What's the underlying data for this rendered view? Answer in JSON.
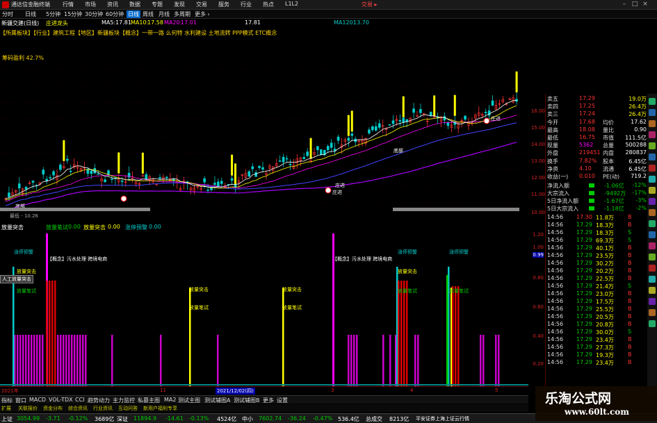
{
  "window": {
    "app_name": "通达信金融终端",
    "broker": "交易 ▸",
    "menu": [
      "行情",
      "市场",
      "资讯",
      "数据",
      "专题",
      "发现",
      "交易",
      "服务",
      "行业",
      "热点",
      "L1L2"
    ]
  },
  "periods": [
    "分时",
    "日线",
    "5分钟",
    "15分钟",
    "30分钟",
    "60分钟",
    "日线",
    "周线",
    "月线",
    "多周期",
    "更多 ›"
  ],
  "active_period_index": 6,
  "stock": {
    "name": "新疆交建(日线)",
    "indicator": "庄进龙头",
    "ma5_label": "MA5:",
    "ma5": "17.81",
    "ma10_label": "MA10:",
    "ma10": "17.58",
    "ma20_label": "MA20:",
    "ma20": "17.01",
    "ma_other": "17.81",
    "ma120_label": "MA120:",
    "ma120": "13.70"
  },
  "tags": "【所属板块】【行业】建筑工程【地区】新疆板块【概念】一带一路 么何特 水利建设 土地流转 PPP模式 ETC概念",
  "profit_label": "筹码盈利 42.7%",
  "chart_annotations": {
    "buy1": "庄进",
    "buy2": "庄进",
    "buy3": "庄进",
    "mark1": "底部",
    "mark2": "底部",
    "lowest": "最低 - 10.26"
  },
  "price_axis": [
    "16.00",
    "15.00",
    "14.00",
    "13.00",
    "12.00",
    "11.00",
    "10.00"
  ],
  "indicator_header": {
    "name": "放量突击",
    "v1_label": "放量笔试",
    "v1": "0.00",
    "v2_label": "放量突击",
    "v2": "0.00",
    "v3_label": "涨停预警",
    "v3": "0.00"
  },
  "ind_axis": [
    "1.20",
    "1.00",
    "0.99",
    "0.80",
    "0.60",
    "0.40",
    "0.20",
    "0.00"
  ],
  "ind_annotations": {
    "zt1": "涨停预警",
    "tj1": "放量突击",
    "cs1": "放量笔试",
    "concept1": "【概念】污水处理 跨境电商",
    "concept2": "【概念】污水处理 跨境电商",
    "tj2": "放量突击",
    "cs2": "放量笔试",
    "tj3": "放量突击",
    "cs3": "放量笔试",
    "zt2": "涨停预警",
    "tj4": "放量突击",
    "cs4": "放量笔试",
    "zt3": "涨停预警",
    "cs5": "放量笔试",
    "tooltip": "人工放量突击"
  },
  "dates": [
    "2021年",
    "11",
    "2021/12/02(四)",
    "3",
    "4",
    "5"
  ],
  "tabs": [
    "指标",
    "窗口",
    "MACD",
    "VOL-TDX",
    "CCI",
    "趋势动力",
    "主力监控",
    "私募主图",
    "MA2",
    "测试主图",
    "测试辅图A",
    "测试辅图B",
    "更多",
    "设置"
  ],
  "tabs2": [
    "扩展",
    "关联报价",
    "资金分布",
    "综合资讯",
    "行业资讯",
    "互动问答",
    "新用户福利专享"
  ],
  "status": {
    "sh_label": "上证",
    "sh": "3054.99",
    "sh_chg": "-3.71",
    "sh_pct": "-0.12%",
    "sh_amt": "3689亿",
    "sz_label": "深证",
    "sz": "11894.9",
    "sz_chg": "-14.61",
    "sz_pct": "-0.13%",
    "sz_amt": "4524亿",
    "zx_label": "中小",
    "zx": "7602.74",
    "zx_chg": "-36.24",
    "zx_pct": "-0.47%",
    "zx_amt": "536.4亿",
    "total_label": "总成交",
    "total": "8213亿",
    "source": "平安证券上海上证云行情"
  },
  "quote": [
    {
      "l": "卖五",
      "v": "17.29",
      "r": "",
      "r2": "19.0万"
    },
    {
      "l": "卖四",
      "v": "17.25",
      "r": "",
      "r2": "26.4万"
    },
    {
      "l": "卖三",
      "v": "17.24",
      "r": "",
      "r2": "26.4万"
    },
    {
      "l": "今开",
      "v": "17.68",
      "r": "均价",
      "r2": "17.62"
    },
    {
      "l": "最高",
      "v": "18.08",
      "r": "量比",
      "r2": "0.90"
    },
    {
      "l": "最低",
      "v": "16.75",
      "r": "市值",
      "r2": "111.5亿"
    },
    {
      "l": "现量",
      "v": "5362",
      "r": "总量",
      "r2": "500288"
    },
    {
      "l": "外盘",
      "v": "219451",
      "r": "内盘",
      "r2": "280837"
    },
    {
      "l": "换手",
      "v": "7.82%",
      "r": "股本",
      "r2": "6.45亿"
    },
    {
      "l": "净资",
      "v": "4.10",
      "r": "流通",
      "r2": "6.45亿"
    },
    {
      "l": "收益(一)",
      "v": "0.010",
      "r": "PE(动)",
      "r2": "719.2"
    }
  ],
  "flows": [
    {
      "l": "净流入额",
      "v": "-1.06亿",
      "p": "-12%"
    },
    {
      "l": "大宗流入",
      "v": "-9492万",
      "p": "-17%"
    },
    {
      "l": "5日净流入额",
      "v": "-1.67亿",
      "p": "-3%"
    },
    {
      "l": "5日大宗流入",
      "v": "-1.18亿",
      "p": "-2%"
    }
  ],
  "ticks": [
    {
      "t": "14:56",
      "p": "17.30",
      "v": "11.8万",
      "d": "B"
    },
    {
      "t": "14:56",
      "p": "17.29",
      "v": "18.3万",
      "d": "B"
    },
    {
      "t": "14:56",
      "p": "17.29",
      "v": "18.3万",
      "d": "S"
    },
    {
      "t": "14:56",
      "p": "17.29",
      "v": "69.3万",
      "d": "S"
    },
    {
      "t": "14:56",
      "p": "17.29",
      "v": "40.1万",
      "d": "B"
    },
    {
      "t": "14:56",
      "p": "17.29",
      "v": "23.5万",
      "d": "B"
    },
    {
      "t": "14:56",
      "p": "17.29",
      "v": "30.2万",
      "d": "B"
    },
    {
      "t": "14:56",
      "p": "17.29",
      "v": "20.2万",
      "d": "B"
    },
    {
      "t": "14:56",
      "p": "17.29",
      "v": "22.5万",
      "d": "B"
    },
    {
      "t": "14:56",
      "p": "17.29",
      "v": "21.4万",
      "d": "S"
    },
    {
      "t": "14:56",
      "p": "17.29",
      "v": "23.0万",
      "d": "B"
    },
    {
      "t": "14:56",
      "p": "17.29",
      "v": "17.5万",
      "d": "B"
    },
    {
      "t": "14:56",
      "p": "17.29",
      "v": "25.5万",
      "d": "B"
    },
    {
      "t": "14:56",
      "p": "17.29",
      "v": "20.5万",
      "d": "B"
    },
    {
      "t": "14:56",
      "p": "17.29",
      "v": "20.8万",
      "d": "B"
    },
    {
      "t": "14:56",
      "p": "17.29",
      "v": "30.0万",
      "d": "S"
    },
    {
      "t": "14:56",
      "p": "17.29",
      "v": "23.4万",
      "d": "B"
    },
    {
      "t": "14:56",
      "p": "17.29",
      "v": "27.3万",
      "d": "B"
    },
    {
      "t": "14:56",
      "p": "17.29",
      "v": "19.3万",
      "d": "B"
    },
    {
      "t": "14:56",
      "p": "17.29",
      "v": "23.4万",
      "d": "B"
    }
  ],
  "watermark": {
    "title": "乐淘公式网",
    "url": "www.60lt.com"
  },
  "colors": {
    "up": "#ff3333",
    "down": "#00cc00",
    "accent": "#ffff00",
    "bg": "#000000"
  }
}
